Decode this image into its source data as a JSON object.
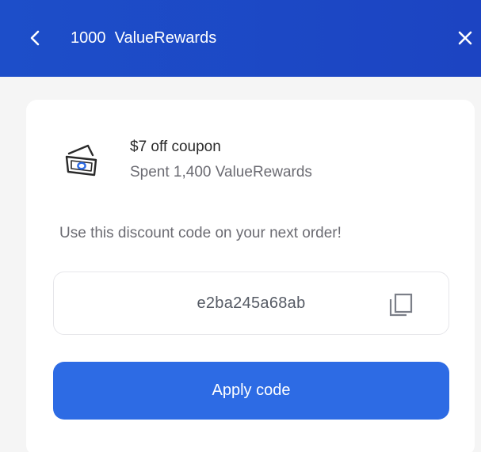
{
  "header": {
    "title": "1000  ValueRewards",
    "back_icon": "chevron-left-icon",
    "close_icon": "close-icon",
    "background": "#1d4ec9"
  },
  "coupon": {
    "icon": "cash-icon",
    "title": "$7 off coupon",
    "subtitle": "Spent 1,400 ValueRewards"
  },
  "instructions": "Use this discount code on your next order!",
  "code": {
    "value": "e2ba245a68ab",
    "copy_icon": "copy-icon"
  },
  "apply_button": {
    "label": "Apply code",
    "color": "#2d6be4"
  }
}
